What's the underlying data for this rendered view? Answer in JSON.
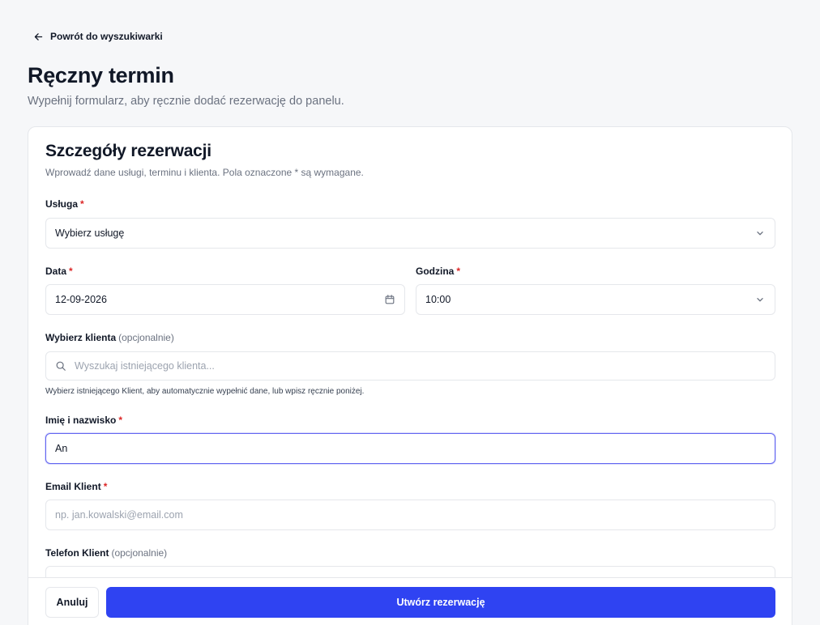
{
  "nav": {
    "back_label": "Powrót do wyszukiwarki",
    "back_icon": "arrow-left-icon"
  },
  "header": {
    "title": "Ręczny termin",
    "subtitle": "Wypełnij formularz, aby ręcznie dodać rezerwację do panelu."
  },
  "card": {
    "title": "Szczegóły rezerwacji",
    "description": "Wprowadź dane usługi, terminu i klienta. Pola oznaczone * są wymagane."
  },
  "form": {
    "service": {
      "label": "Usługa",
      "required": "*",
      "value": "Wybierz usługę",
      "icon": "chevron-down-icon"
    },
    "date": {
      "label": "Data",
      "required": "*",
      "value": "12-09-2026",
      "icon": "calendar-icon"
    },
    "time": {
      "label": "Godzina",
      "required": "*",
      "value": "10:00",
      "icon": "chevron-down-icon"
    },
    "client_select": {
      "label": "Wybierz klienta",
      "optional": "(opcjonalnie)",
      "placeholder": "Wyszukaj istniejącego klienta...",
      "icon": "search-icon",
      "hint": "Wybierz istniejącego Klient, aby automatycznie wypełnić dane, lub wpisz ręcznie poniżej."
    },
    "full_name": {
      "label": "Imię i nazwisko",
      "required": "*",
      "value": "An"
    },
    "email": {
      "label": "Email Klient",
      "required": "*",
      "placeholder": "np. jan.kowalski@email.com"
    },
    "phone": {
      "label": "Telefon Klient",
      "optional": "(opcjonalnie)"
    }
  },
  "footer": {
    "cancel_label": "Anuluj",
    "submit_label": "Utwórz rezerwację"
  },
  "colors": {
    "primary": "#2f43f2",
    "required": "#dc2626",
    "focus": "#6366f1"
  }
}
